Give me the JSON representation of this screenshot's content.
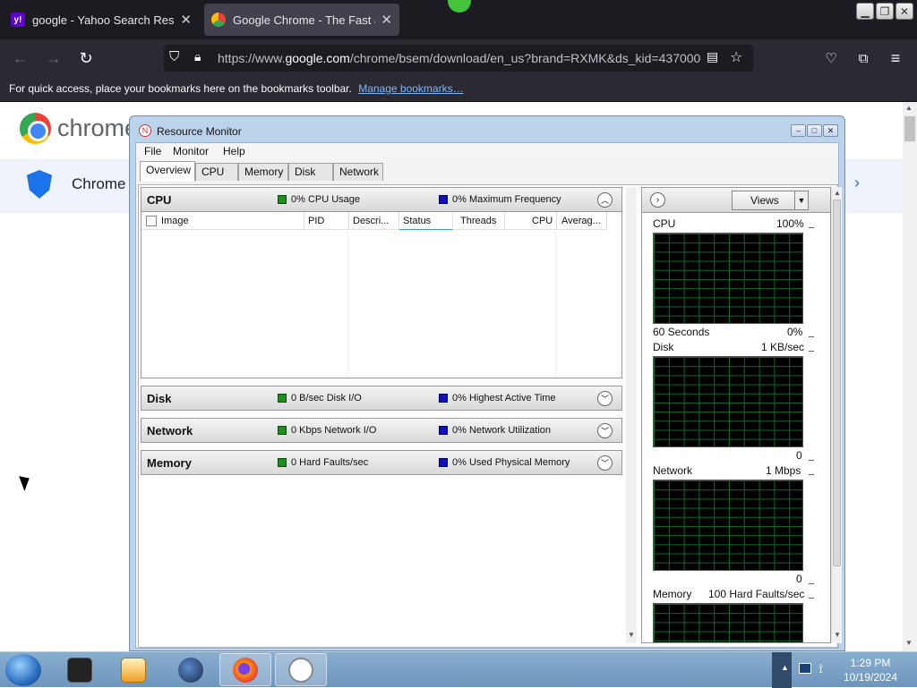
{
  "browser": {
    "tabs": [
      {
        "label": "google - Yahoo Search Results",
        "icon": "yahoo-icon"
      },
      {
        "label": "Google Chrome - The Fast & Se",
        "icon": "chrome-icon"
      }
    ],
    "url_prefix": "https://www.",
    "url_domain": "google.com",
    "url_rest": "/chrome/bsem/download/en_us?brand=RXMK&ds_kid=437000",
    "bookmarks_text": "For quick access, place your bookmarks here on the bookmarks toolbar.",
    "bookmarks_link": "Manage bookmarks…"
  },
  "webpage": {
    "logo_text": "chrome",
    "subnav_text": "Chrome"
  },
  "resource_monitor": {
    "title": "Resource Monitor",
    "menus": [
      "File",
      "Monitor",
      "Help"
    ],
    "tabs": [
      "Overview",
      "CPU",
      "Memory",
      "Disk",
      "Network"
    ],
    "cpu": {
      "title": "CPU",
      "stat1": "0% CPU Usage",
      "stat2": "0% Maximum Frequency"
    },
    "columns": [
      "Image",
      "PID",
      "Descri...",
      "Status",
      "Threads",
      "CPU",
      "Averag..."
    ],
    "disk": {
      "title": "Disk",
      "stat1": "0 B/sec Disk I/O",
      "stat2": "0% Highest Active Time"
    },
    "network": {
      "title": "Network",
      "stat1": "0 Kbps Network I/O",
      "stat2": "0% Network Utilization"
    },
    "memory": {
      "title": "Memory",
      "stat1": "0 Hard Faults/sec",
      "stat2": "0% Used Physical Memory"
    },
    "views_label": "Views",
    "graphs": [
      {
        "name": "CPU",
        "max": "100%",
        "bottom_left": "60 Seconds",
        "bottom_right": "0%"
      },
      {
        "name": "Disk",
        "max": "1 KB/sec",
        "bottom_left": "",
        "bottom_right": "0"
      },
      {
        "name": "Network",
        "max": "1 Mbps",
        "bottom_left": "",
        "bottom_right": "0"
      },
      {
        "name": "Memory",
        "max": "100 Hard Faults/sec"
      }
    ]
  },
  "taskbar": {
    "time": "1:29 PM",
    "date": "10/19/2024"
  },
  "colors": {
    "graph_grid": "#0b6b2b",
    "green_square": "#1e8e1e",
    "blue_square": "#1010c0"
  }
}
